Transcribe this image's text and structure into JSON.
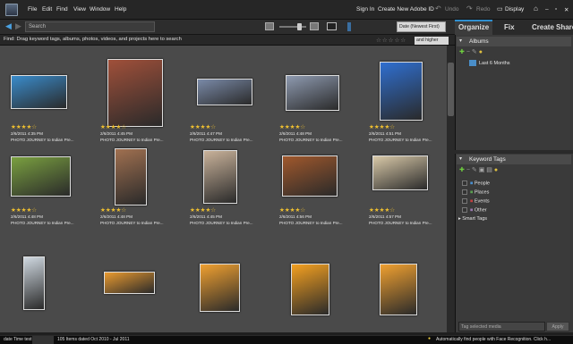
{
  "menu": {
    "items": [
      "File",
      "Edit",
      "Find",
      "View",
      "Window",
      "Help"
    ]
  },
  "topbar": {
    "sign_in": "Sign In",
    "create_id": "Create New Adobe ID",
    "undo": "Undo",
    "redo": "Redo",
    "display": "Display"
  },
  "search": {
    "placeholder": "Search"
  },
  "sort": {
    "selected": "Date (Newest First)"
  },
  "findbar": {
    "text": "Find: Drag keyword tags, albums, photos, videos, and projects here to search",
    "rating_filter": "and higher"
  },
  "tabs": [
    "Organize",
    "Fix",
    "Create",
    "Share"
  ],
  "albums": {
    "title": "Albums",
    "items": [
      "Last 6 Months"
    ]
  },
  "keyword_tags": {
    "title": "Keyword Tags",
    "items": [
      "People",
      "Places",
      "Events",
      "Other"
    ],
    "smart_tags": "Smart Tags",
    "tag_selected_placeholder": "Tag selected media",
    "apply": "Apply"
  },
  "grid": {
    "caption": "PHOTO JOURNEY to Indian Pre...",
    "items": [
      {
        "date": "2/6/2011 4:35 PM",
        "stars": "★★★★",
        "color": "#3a8ccc"
      },
      {
        "date": "2/6/2011 4:45 PM",
        "stars": "★★★★",
        "color": "#a0503a"
      },
      {
        "date": "2/6/2011 4:47 PM",
        "stars": "★★★★",
        "color": "#7a8aa8"
      },
      {
        "date": "2/6/2011 4:48 PM",
        "stars": "★★★★",
        "color": "#8e9ab0"
      },
      {
        "date": "2/6/2011 4:51 PM",
        "stars": "★★★★",
        "color": "#2f6fd0"
      },
      {
        "date": "2/6/2011 4:48 PM",
        "stars": "★★★★",
        "color": "#7aa040"
      },
      {
        "date": "2/6/2011 4:48 PM",
        "stars": "★★★★",
        "color": "#a07050"
      },
      {
        "date": "2/6/2011 4:45 PM",
        "stars": "★★★★",
        "color": "#c9b29a"
      },
      {
        "date": "2/6/2011 4:56 PM",
        "stars": "★★★★",
        "color": "#a0582c"
      },
      {
        "date": "2/6/2011 4:57 PM",
        "stars": "★★★★",
        "color": "#d9c9a8"
      },
      {
        "date": "",
        "stars": "",
        "color": "#cfd8e0"
      },
      {
        "date": "",
        "stars": "",
        "color": "#e89a30"
      },
      {
        "date": "",
        "stars": "",
        "color": "#f0a030"
      },
      {
        "date": "",
        "stars": "",
        "color": "#f4a020"
      },
      {
        "date": "",
        "stars": "",
        "color": "#f0a030"
      }
    ]
  },
  "status": {
    "left": "date Time test",
    "count": "105 Items dated Oct 2010 - Jul 2011",
    "right": "Automatically find people with Face Recognition. Click h..."
  },
  "colors": {
    "accent": "#2f8fd0",
    "panel": "#3a3a3a",
    "grid_bg": "#4a4a4a",
    "star": "#f0c030"
  }
}
